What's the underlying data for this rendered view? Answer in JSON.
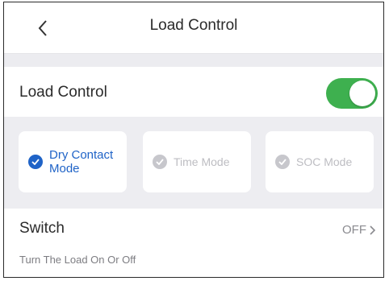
{
  "header": {
    "title": "Load Control",
    "back_icon": "chevron-left-icon"
  },
  "load_control": {
    "label": "Load Control",
    "enabled": true,
    "toggle_color": "#3eb04f"
  },
  "modes": [
    {
      "label": "Dry Contact Mode",
      "line1": "Dry Contact",
      "line2": "Mode",
      "selected": true
    },
    {
      "label": "Time Mode",
      "selected": false
    },
    {
      "label": "SOC Mode",
      "selected": false
    }
  ],
  "switch": {
    "label": "Switch",
    "value": "OFF",
    "description": "Turn The Load On Or Off",
    "chevron_icon": "chevron-right-icon"
  },
  "colors": {
    "accent": "#1f63c7",
    "disabled": "#c7c7cc"
  }
}
